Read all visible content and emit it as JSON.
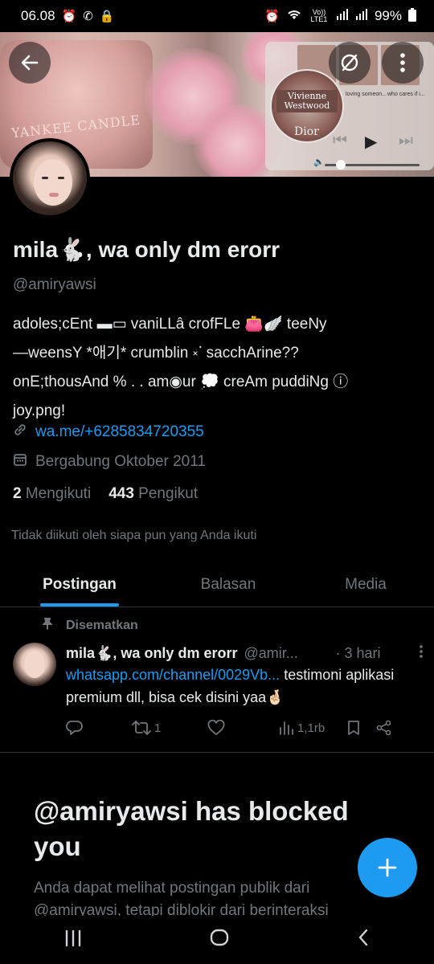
{
  "status_bar": {
    "time": "06.08",
    "left_icons": [
      "alarm-clock-icon",
      "whatsapp-icon",
      "lock-icon"
    ],
    "right_icons": [
      "alarm-icon",
      "wifi-icon",
      "volte-icon",
      "signal-icon",
      "signal-icon",
      "battery-icon"
    ],
    "volte_label": "Vo)) LTE1",
    "battery": "99%"
  },
  "banner": {
    "candle_label": "YANKEE CANDLE",
    "music_brand": "Vivienne Westwood",
    "music_brand_2": "Dior",
    "captions": [
      "loving someon...",
      "who cares if i...",
      "P Pars"
    ]
  },
  "header": {
    "back_icon": "arrow-left-icon",
    "mute_icon": "slash-circle-icon",
    "more_icon": "more-vertical-icon"
  },
  "profile": {
    "display_name": "mila🐇, wa only dm erorr",
    "handle": "@amiryawsi",
    "bio": "adoles;cEnt ▬▭ vaniLLâ crofFLe 👛🪽 teeNy\n—weensY *애기* crumblin ༝ᐝ sacchArine??\nonE;thousAnd % . . am◉ur 💭 creAm puddiNg ⓘ\njoy.png!",
    "link": "wa.me/+6285834720355",
    "joined": "Bergabung Oktober 2011",
    "following_count": "2",
    "following_label": "Mengikuti",
    "followers_count": "443",
    "followers_label": "Pengikut",
    "not_followed": "Tidak diikuti oleh siapa pun yang Anda ikuti"
  },
  "tabs": [
    {
      "label": "Postingan",
      "active": true
    },
    {
      "label": "Balasan",
      "active": false
    },
    {
      "label": "Media",
      "active": false
    }
  ],
  "pinned_post": {
    "pinned_label": "Disematkan",
    "name": "mila🐇, wa only dm erorr",
    "handle": "@amir...",
    "time": "· 3 hari",
    "link_text": "whatsapp.com/channel/0029Vb...",
    "text": " testimoni aplikasi premium dll, bisa cek disini yaa🤞🏻",
    "reply_count": "",
    "repost_count": "1",
    "like_count": "",
    "views": "1,1rb"
  },
  "blocked": {
    "title": "@amiryawsi has blocked you",
    "subtitle": "Anda dapat melihat postingan publik dari @amiryawsi, tetapi diblokir dari berinteraksi"
  },
  "fab": {
    "icon": "plus-icon",
    "label": "+"
  },
  "nav": {
    "recents": "|||",
    "home": "◯",
    "back": "〈"
  },
  "colors": {
    "accent": "#1d9bf0",
    "background": "#000000",
    "muted": "#71767b"
  }
}
